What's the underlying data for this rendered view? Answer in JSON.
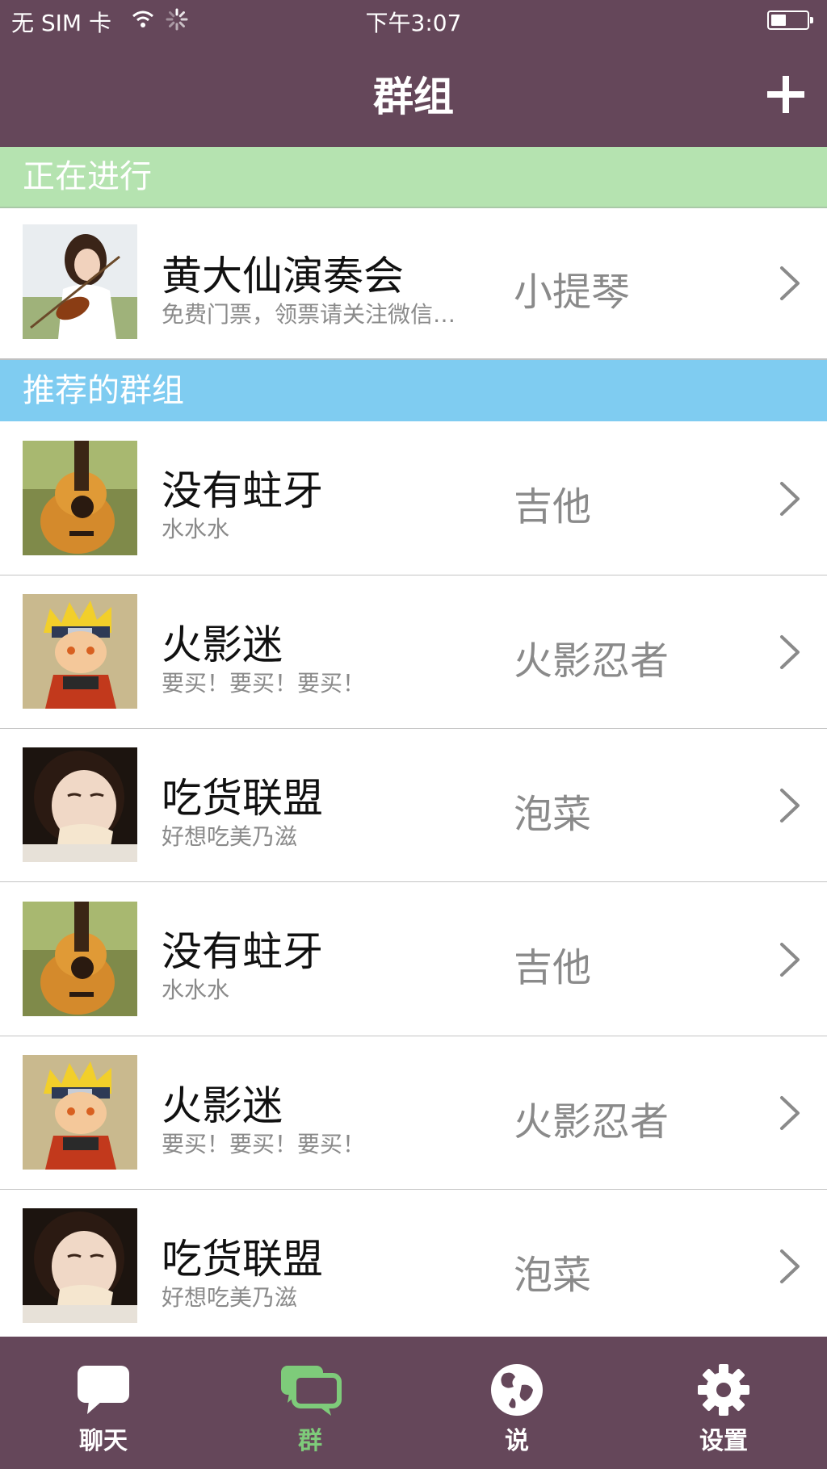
{
  "status_bar": {
    "carrier": "无 SIM 卡",
    "time": "下午3:07"
  },
  "nav": {
    "title": "群组"
  },
  "sections": {
    "active": "正在进行",
    "recommended": "推荐的群组"
  },
  "active_group": {
    "name": "黄大仙演奏会",
    "desc": "免费门票，领票请关注微信…",
    "tag": "小提琴",
    "avatar": "violin-girl"
  },
  "groups": [
    {
      "name": "没有蛀牙",
      "desc": "水水水",
      "tag": "吉他",
      "avatar": "guitar"
    },
    {
      "name": "火影迷",
      "desc": "要买！要买！要买！",
      "tag": "火影忍者",
      "avatar": "naruto"
    },
    {
      "name": "吃货联盟",
      "desc": "好想吃美乃滋",
      "tag": "泡菜",
      "avatar": "girl-eating-bread"
    },
    {
      "name": "没有蛀牙",
      "desc": "水水水",
      "tag": "吉他",
      "avatar": "guitar"
    },
    {
      "name": "火影迷",
      "desc": "要买！要买！要买！",
      "tag": "火影忍者",
      "avatar": "naruto"
    },
    {
      "name": "吃货联盟",
      "desc": "好想吃美乃滋",
      "tag": "泡菜",
      "avatar": "girl-eating-bread"
    }
  ],
  "tabs": [
    {
      "label": "聊天",
      "icon": "chat-bubble-icon"
    },
    {
      "label": "群",
      "icon": "group-chat-icon"
    },
    {
      "label": "说",
      "icon": "globe-icon"
    },
    {
      "label": "设置",
      "icon": "gear-icon"
    }
  ],
  "colors": {
    "bar": "#65475a",
    "active_section": "#b5e3b0",
    "recommended_section": "#7fccf1",
    "active_tab": "#7ecb7a"
  }
}
